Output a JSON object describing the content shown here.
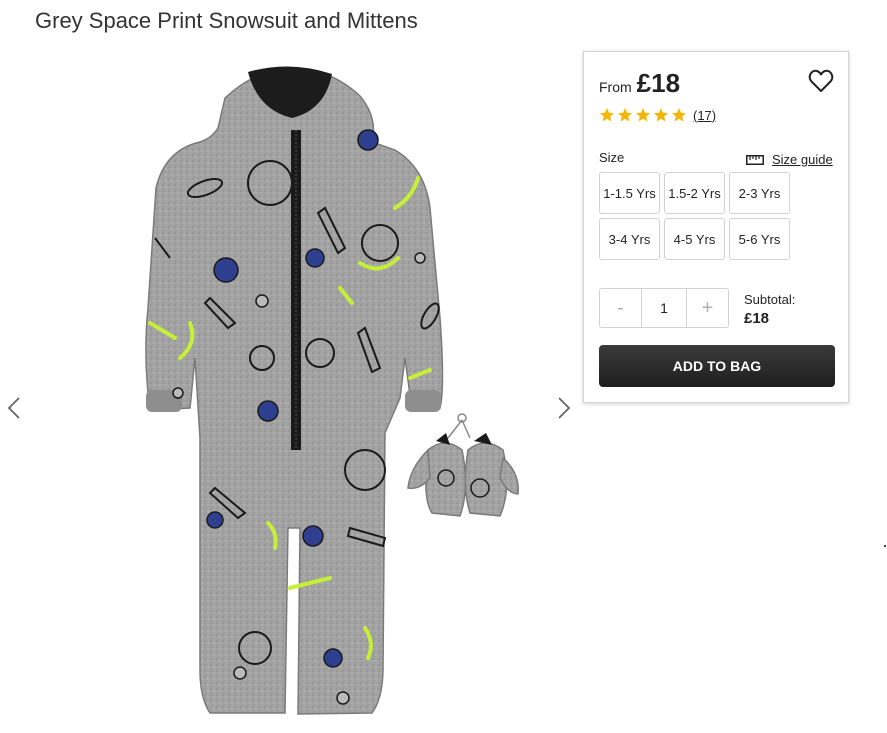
{
  "product": {
    "title": "Grey Space Print Snowsuit and Mittens"
  },
  "gallery": {
    "prev_icon": "chevron-left-icon",
    "next_icon": "chevron-right-icon"
  },
  "buy_panel": {
    "price_prefix": "From",
    "price": "£18",
    "wishlist_icon": "heart-outline-icon",
    "rating": {
      "stars": 5,
      "max": 5,
      "review_count": "(17)",
      "star_color": "#f2b705"
    },
    "size_label": "Size",
    "size_guide_icon": "ruler-icon",
    "size_guide_label": "Size guide",
    "sizes": [
      "1-1.5 Yrs",
      "1.5-2 Yrs",
      "2-3 Yrs",
      "3-4 Yrs",
      "4-5 Yrs",
      "5-6 Yrs"
    ],
    "quantity": {
      "minus_label": "-",
      "value": "1",
      "plus_label": "+"
    },
    "subtotal_label": "Subtotal:",
    "subtotal_value": "£18",
    "add_to_bag_label": "ADD TO BAG"
  },
  "colors": {
    "suit_grey": "#9c9c9c",
    "accent_lime": "#c6f038",
    "accent_navy": "#2e3f8f",
    "button_dark": "#262626"
  }
}
